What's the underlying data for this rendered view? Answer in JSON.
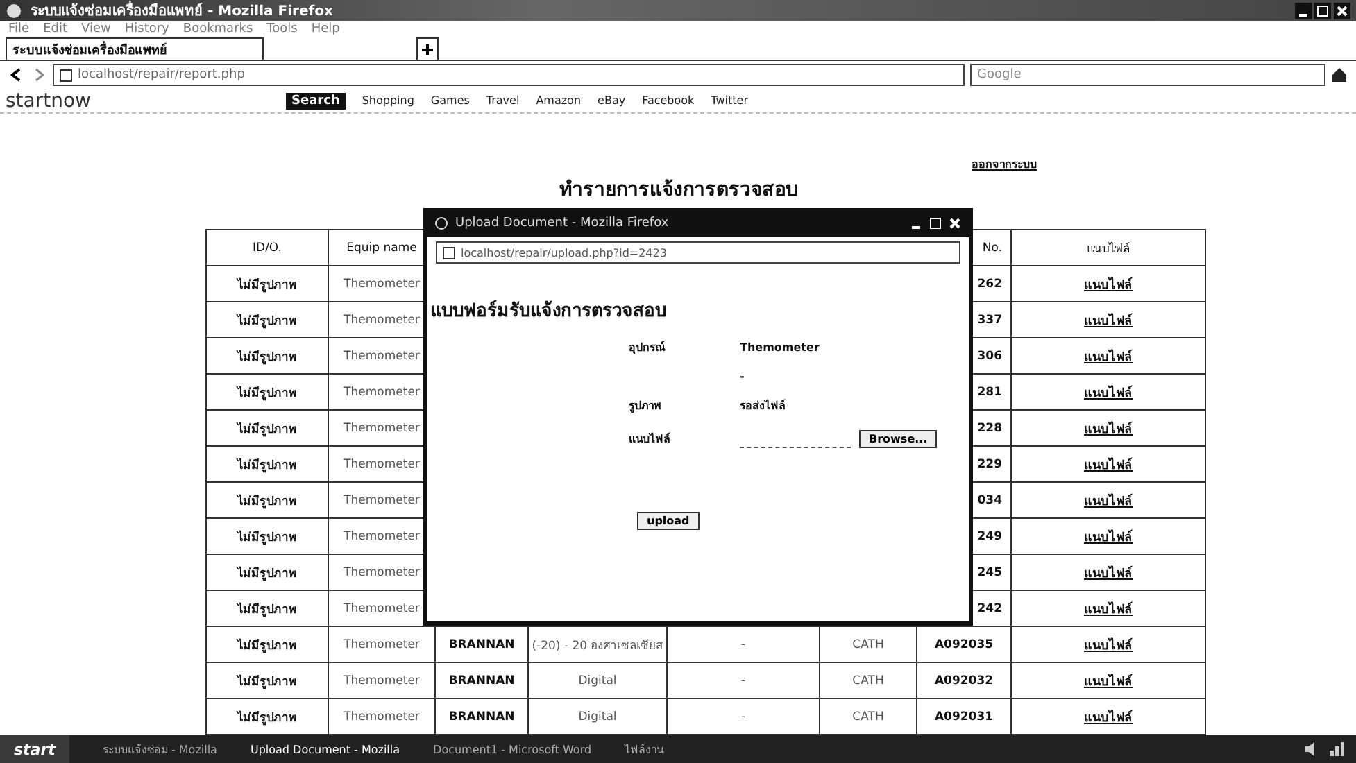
{
  "window": {
    "title": "ระบบแจ้งซ่อมเครื่องมือแพทย์ - Mozilla Firefox"
  },
  "menu": [
    "File",
    "Edit",
    "View",
    "History",
    "Bookmarks",
    "Tools",
    "Help"
  ],
  "tabs": [
    {
      "label": "ระบบแจ้งซ่อมเครื่องมือแพทย์",
      "selected": true
    }
  ],
  "address": {
    "url": "localhost/repair/report.php",
    "search_placeholder": "Google"
  },
  "toolbar": {
    "brand": "startnow",
    "search_button": "Search",
    "links": [
      "Shopping",
      "Games",
      "Travel",
      "Amazon",
      "eBay",
      "Facebook",
      "Twitter"
    ]
  },
  "page": {
    "top_link": "ออกจากระบบ",
    "title": "ทำรายการแจ้งการตรวจสอบ",
    "columns": [
      "ID/O.",
      "Equip name",
      "",
      "",
      "",
      "",
      "No.",
      "แนบไฟล์"
    ],
    "rows": [
      {
        "kind": "covered",
        "cells": [
          "ไม่มีรูปภาพ",
          "Themometer",
          "262",
          "แนบไฟล์"
        ]
      },
      {
        "kind": "covered",
        "cells": [
          "ไม่มีรูปภาพ",
          "Themometer",
          "337",
          "แนบไฟล์"
        ]
      },
      {
        "kind": "covered",
        "cells": [
          "ไม่มีรูปภาพ",
          "Themometer",
          "306",
          "แนบไฟล์"
        ]
      },
      {
        "kind": "covered",
        "cells": [
          "ไม่มีรูปภาพ",
          "Themometer",
          "281",
          "แนบไฟล์"
        ]
      },
      {
        "kind": "covered",
        "cells": [
          "ไม่มีรูปภาพ",
          "Themometer",
          "228",
          "แนบไฟล์"
        ]
      },
      {
        "kind": "covered",
        "cells": [
          "ไม่มีรูปภาพ",
          "Themometer",
          "229",
          "แนบไฟล์"
        ]
      },
      {
        "kind": "covered",
        "cells": [
          "ไม่มีรูปภาพ",
          "Themometer",
          "034",
          "แนบไฟล์"
        ]
      },
      {
        "kind": "covered",
        "cells": [
          "ไม่มีรูปภาพ",
          "Themometer",
          "249",
          "แนบไฟล์"
        ]
      },
      {
        "kind": "covered",
        "cells": [
          "ไม่มีรูปภาพ",
          "Themometer",
          "245",
          "แนบไฟล์"
        ]
      },
      {
        "kind": "covered",
        "cells": [
          "ไม่มีรูปภาพ",
          "Themometer",
          "242",
          "แนบไฟล์"
        ]
      },
      {
        "kind": "full",
        "cells": [
          "ไม่มีรูปภาพ",
          "Themometer",
          "BRANNAN",
          "(-20) - 20 องศาเซลเซียส",
          "-",
          "CATH",
          "A092035",
          "แนบไฟล์"
        ]
      },
      {
        "kind": "full",
        "cells": [
          "ไม่มีรูปภาพ",
          "Themometer",
          "BRANNAN",
          "Digital",
          "-",
          "CATH",
          "A092032",
          "แนบไฟล์"
        ]
      },
      {
        "kind": "full",
        "cells": [
          "ไม่มีรูปภาพ",
          "Themometer",
          "BRANNAN",
          "Digital",
          "-",
          "CATH",
          "A092031",
          "แนบไฟล์"
        ]
      }
    ]
  },
  "popup": {
    "title": "Upload Document - Mozilla Firefox",
    "url": "localhost/repair/upload.php?id=2423",
    "heading": "แบบฟอร์มรับแจ้งการตรวจสอบ",
    "fields": [
      {
        "label": "อุปกรณ์",
        "value": "Themometer"
      },
      {
        "value": "-"
      },
      {
        "label": "รูปภาพ",
        "value": "รอส่งไฟล์"
      }
    ],
    "file_label": "แนบไฟล์",
    "browse": "Browse...",
    "upload": "upload"
  },
  "taskbar": {
    "start": "start",
    "items": [
      {
        "label": "ระบบแจ้งซ่อม - Mozilla",
        "selected": false
      },
      {
        "label": "Upload Document - Mozilla",
        "selected": true
      },
      {
        "label": "Document1 - Microsoft Word",
        "selected": false
      },
      {
        "label": "ไฟล์งาน",
        "selected": false
      }
    ]
  }
}
